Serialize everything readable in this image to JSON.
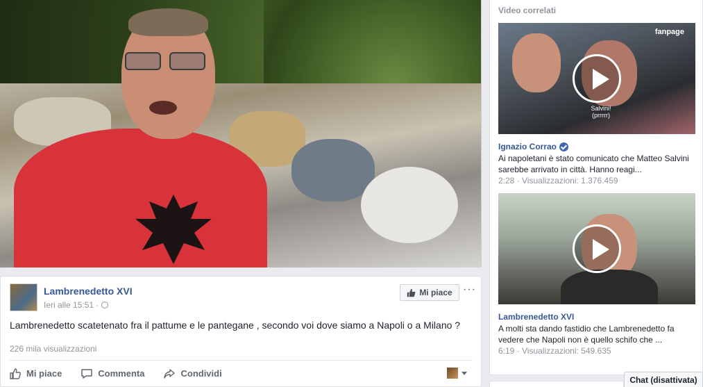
{
  "main_video": {
    "alt_subject": "video-frame"
  },
  "post": {
    "author": "Lambrenedetto XVI",
    "timestamp": "Ieri alle 15:51 ·",
    "like_page_label": "Mi piace",
    "more_label": "···",
    "text": "Lambrenedetto scatetenato fra il pattume e le pantegane , secondo voi dove siamo a Napoli o a Milano ?",
    "views": "226 mila visualizzazioni",
    "actions": {
      "like": "Mi piace",
      "comment": "Commenta",
      "share": "Condividi"
    }
  },
  "related": {
    "title": "Video correlati",
    "items": [
      {
        "author": "Ignazio Corrao",
        "verified": true,
        "badge": "fanpage",
        "caption_line1": "Salvini!",
        "caption_line2": "(prrrrr)",
        "desc_line1": "Ai napoletani è stato comunicato che Matteo Salvini",
        "desc_line2": "sarebbe arrivato in città. Hanno reagi...",
        "meta": "2:28 · Visualizzazioni: 1.376.459"
      },
      {
        "author": "Lambrenedetto XVI",
        "verified": false,
        "desc_line1": "A molti sta dando fastidio che Lambrenedetto fa",
        "desc_line2": "vedere che Napoli non è quello schifo che ...",
        "meta": "6:19 · Visualizzazioni: 549.635"
      }
    ]
  },
  "chat": {
    "label": "Chat (disattivata)"
  },
  "colors": {
    "link_blue": "#365899",
    "meta_gray": "#90949c",
    "page_bg": "#e9ebee",
    "shirt_red": "#d8323a"
  }
}
